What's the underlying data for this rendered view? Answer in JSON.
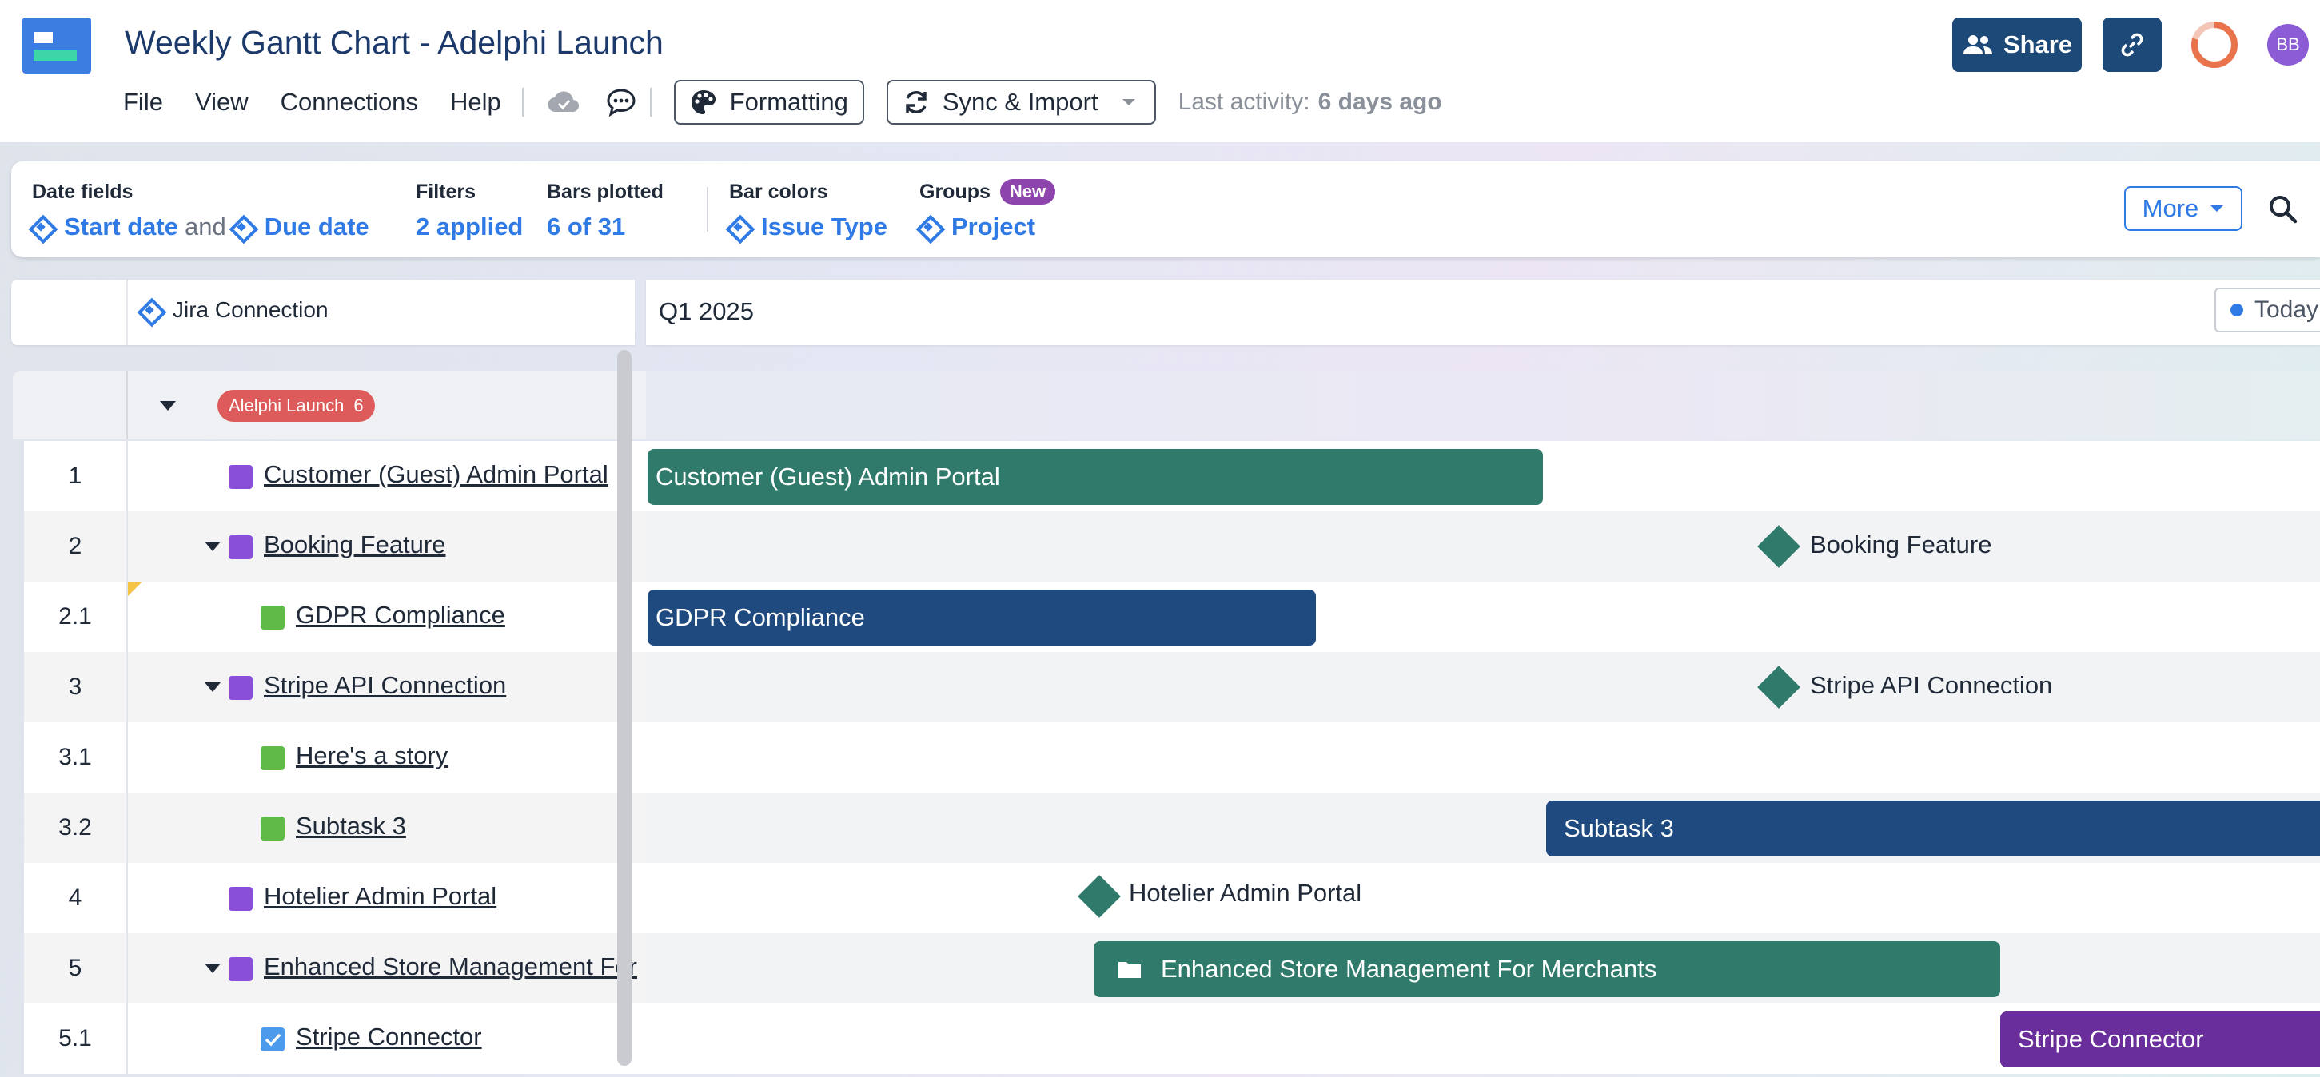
{
  "app": {
    "title": "Weekly Gantt Chart - Adelphi Launch",
    "logo_icon": "gantt-logo-icon"
  },
  "menu": {
    "file": "File",
    "view": "View",
    "connections": "Connections",
    "help": "Help"
  },
  "toolbar": {
    "formatting_label": "Formatting",
    "sync_label": "Sync & Import",
    "last_activity_label": "Last activity:",
    "last_activity_value": "6 days ago",
    "share_label": "Share",
    "avatar_initials": "BB",
    "accent_color": "#1d4979"
  },
  "settings": {
    "date_fields_label": "Date fields",
    "start_date": "Start date",
    "and_text": "and",
    "due_date": "Due date",
    "filters_label": "Filters",
    "filters_value": "2 applied",
    "bars_plotted_label": "Bars plotted",
    "bars_plotted_value": "6 of 31",
    "bar_colors_label": "Bar colors",
    "bar_colors_value": "Issue Type",
    "groups_label": "Groups",
    "groups_badge": "New",
    "groups_value": "Project",
    "more_label": "More"
  },
  "grid": {
    "connection_label": "Jira Connection",
    "timeline_period": "Q1 2025",
    "today_label": "Today",
    "group": {
      "name": "Alelphi Launch",
      "count": "6",
      "color": "#de5b5b"
    },
    "rows": [
      {
        "num": "1",
        "name": "Customer (Guest) Admin Portal",
        "type": "epic",
        "bar_label": "Customer (Guest) Admin Portal",
        "bar_color": "#2f7a6a"
      },
      {
        "num": "2",
        "name": "Booking Feature",
        "type": "epic",
        "milestone_label": "Booking Feature",
        "milestone_color": "#2f7a6a"
      },
      {
        "num": "2.1",
        "name": "GDPR Compliance",
        "type": "story",
        "bar_label": "GDPR Compliance",
        "bar_color": "#1f4a80"
      },
      {
        "num": "3",
        "name": "Stripe API Connection",
        "type": "epic",
        "milestone_label": "Stripe API Connection",
        "milestone_color": "#2f7a6a"
      },
      {
        "num": "3.1",
        "name": "Here's a story",
        "type": "story",
        "bar_color": "#1f4a80"
      },
      {
        "num": "3.2",
        "name": "Subtask 3",
        "type": "story",
        "bar_label": "Subtask 3",
        "bar_color": "#1f4a80"
      },
      {
        "num": "4",
        "name": "Hotelier Admin Portal",
        "type": "epic",
        "milestone_label": "Hotelier Admin Portal",
        "milestone_color": "#2f7a6a"
      },
      {
        "num": "5",
        "name": "Enhanced Store Management For",
        "type": "epic",
        "bar_label": "Enhanced Store Management For Merchants",
        "bar_color": "#2f7a6a"
      },
      {
        "num": "5.1",
        "name": "Stripe Connector",
        "type": "task",
        "bar_label": "Stripe Connector",
        "bar_color": "#6a2d9c"
      }
    ]
  }
}
